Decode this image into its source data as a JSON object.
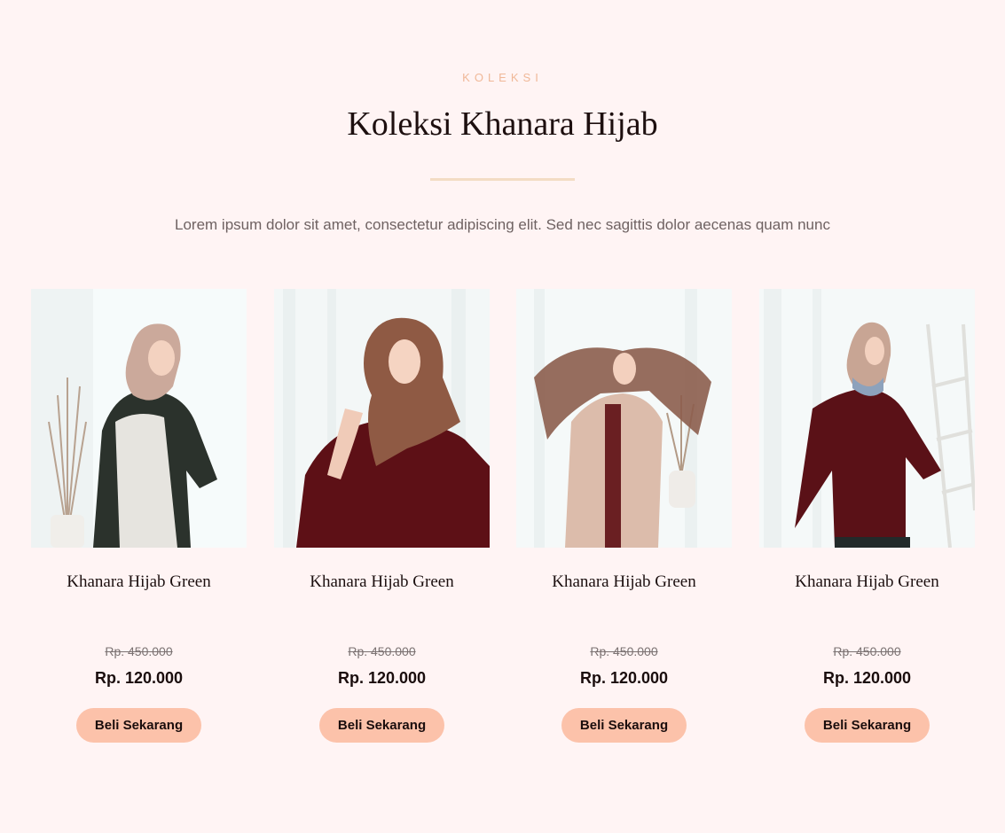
{
  "section": {
    "eyebrow": "KOLEKSI",
    "title": "Koleksi Khanara Hijab",
    "subtitle": "Lorem ipsum dolor sit amet, consectetur adipiscing elit. Sed nec sagittis dolor aecenas quam nunc"
  },
  "colors": {
    "background": "#fff4f4",
    "accent": "#fcc2aa",
    "eyebrow": "#f0b898",
    "divider": "#f3dcc4"
  },
  "products": [
    {
      "name": "Khanara Hijab Green",
      "old_price": "Rp. 450.000",
      "price": "Rp. 120.000",
      "button_label": "Beli Sekarang"
    },
    {
      "name": "Khanara Hijab Green",
      "old_price": "Rp. 450.000",
      "price": "Rp. 120.000",
      "button_label": "Beli Sekarang"
    },
    {
      "name": "Khanara Hijab Green",
      "old_price": "Rp. 450.000",
      "price": "Rp. 120.000",
      "button_label": "Beli Sekarang"
    },
    {
      "name": "Khanara Hijab Green",
      "old_price": "Rp. 450.000",
      "price": "Rp. 120.000",
      "button_label": "Beli Sekarang"
    }
  ]
}
